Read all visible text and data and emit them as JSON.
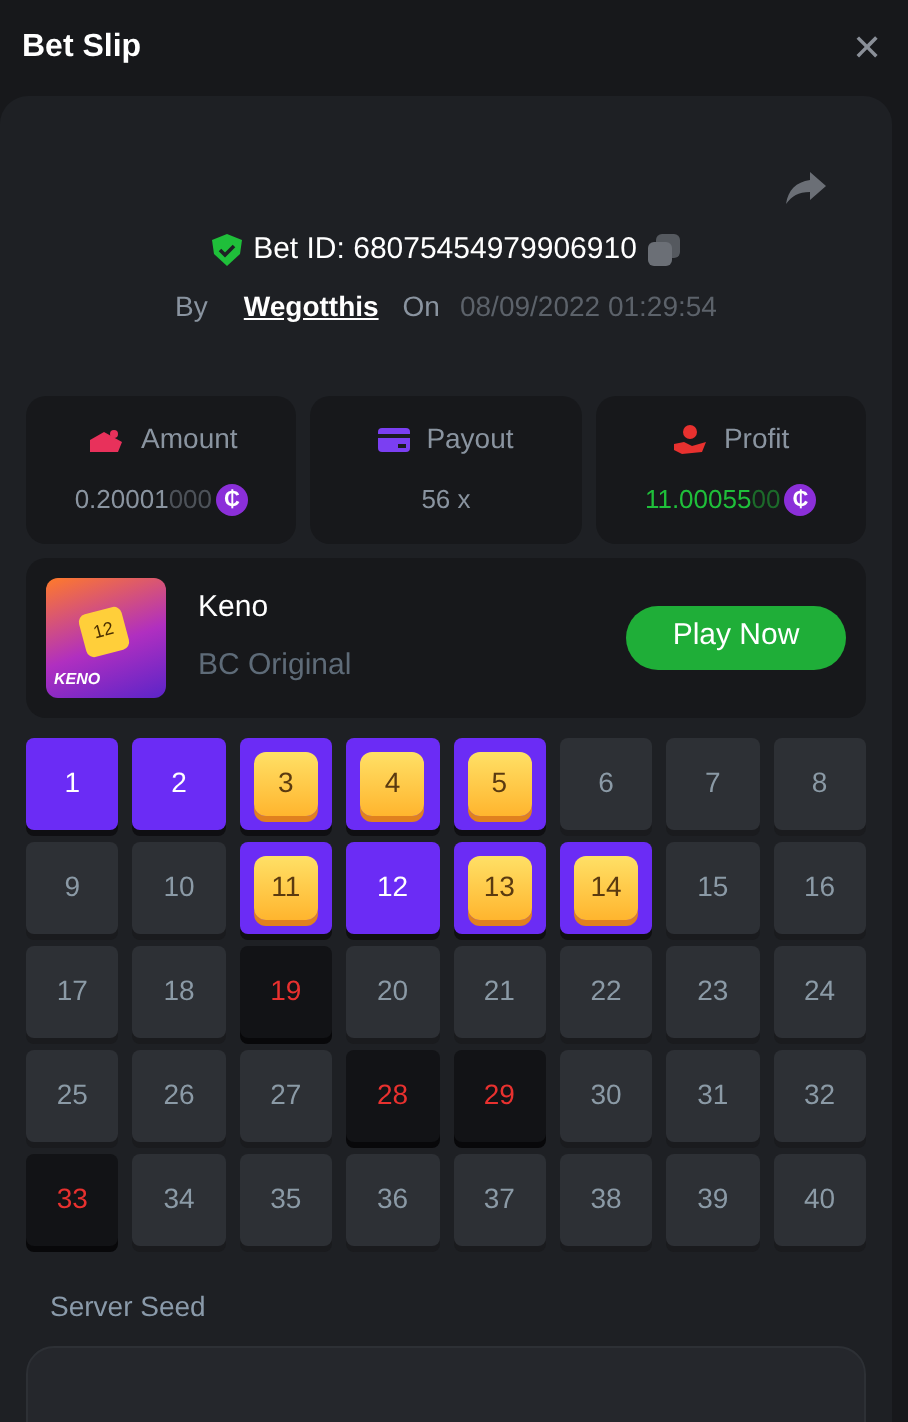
{
  "header": {
    "title": "Bet Slip",
    "close": "✕"
  },
  "bet": {
    "id_label": "Bet ID: 68075454979906910",
    "by_label": "By",
    "user": "Wegotthis",
    "on_label": "On",
    "date": "08/09/2022 01:29:54"
  },
  "stats": [
    {
      "kind": "amount",
      "label": "Amount",
      "value": "0.20001",
      "value_tail": "000",
      "coin": "₵"
    },
    {
      "kind": "payout",
      "label": "Payout",
      "value": "56 x"
    },
    {
      "kind": "profit",
      "label": "Profit",
      "value": "11.00055",
      "value_tail": "00",
      "coin": "₵"
    }
  ],
  "game": {
    "name": "Keno",
    "subtitle": "BC Original",
    "logo_text": "KENO",
    "tile_number": "12",
    "button": "Play Now"
  },
  "cells": [
    {
      "n": "1",
      "kind": "picked"
    },
    {
      "n": "2",
      "kind": "picked"
    },
    {
      "n": "3",
      "kind": "hit"
    },
    {
      "n": "4",
      "kind": "hit"
    },
    {
      "n": "5",
      "kind": "hit"
    },
    {
      "n": "6",
      "kind": "empty"
    },
    {
      "n": "7",
      "kind": "empty"
    },
    {
      "n": "8",
      "kind": "empty"
    },
    {
      "n": "9",
      "kind": "empty"
    },
    {
      "n": "10",
      "kind": "empty"
    },
    {
      "n": "11",
      "kind": "hit"
    },
    {
      "n": "12",
      "kind": "picked"
    },
    {
      "n": "13",
      "kind": "hit"
    },
    {
      "n": "14",
      "kind": "hit"
    },
    {
      "n": "15",
      "kind": "empty"
    },
    {
      "n": "16",
      "kind": "empty"
    },
    {
      "n": "17",
      "kind": "empty"
    },
    {
      "n": "18",
      "kind": "empty"
    },
    {
      "n": "19",
      "kind": "drawn"
    },
    {
      "n": "20",
      "kind": "empty"
    },
    {
      "n": "21",
      "kind": "empty"
    },
    {
      "n": "22",
      "kind": "empty"
    },
    {
      "n": "23",
      "kind": "empty"
    },
    {
      "n": "24",
      "kind": "empty"
    },
    {
      "n": "25",
      "kind": "empty"
    },
    {
      "n": "26",
      "kind": "empty"
    },
    {
      "n": "27",
      "kind": "empty"
    },
    {
      "n": "28",
      "kind": "drawn"
    },
    {
      "n": "29",
      "kind": "drawn"
    },
    {
      "n": "30",
      "kind": "empty"
    },
    {
      "n": "31",
      "kind": "empty"
    },
    {
      "n": "32",
      "kind": "empty"
    },
    {
      "n": "33",
      "kind": "drawn"
    },
    {
      "n": "34",
      "kind": "empty"
    },
    {
      "n": "35",
      "kind": "empty"
    },
    {
      "n": "36",
      "kind": "empty"
    },
    {
      "n": "37",
      "kind": "empty"
    },
    {
      "n": "38",
      "kind": "empty"
    },
    {
      "n": "39",
      "kind": "empty"
    },
    {
      "n": "40",
      "kind": "empty"
    }
  ],
  "server_seed": {
    "label": "Server Seed"
  }
}
